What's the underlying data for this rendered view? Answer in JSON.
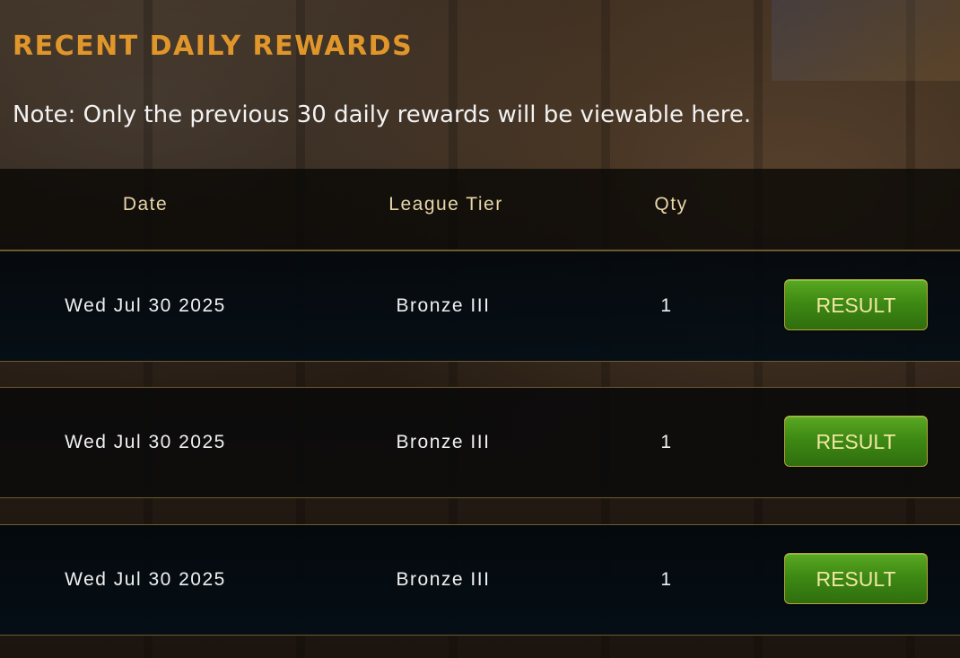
{
  "page": {
    "title": "RECENT DAILY REWARDS",
    "note": "Note: Only the previous 30 daily rewards will be viewable here."
  },
  "table": {
    "headers": {
      "date": "Date",
      "tier": "League Tier",
      "qty": "Qty"
    },
    "rows": [
      {
        "date": "Wed Jul 30 2025",
        "tier": "Bronze III",
        "qty": "1",
        "button": "RESULT"
      },
      {
        "date": "Wed Jul 30 2025",
        "tier": "Bronze III",
        "qty": "1",
        "button": "RESULT"
      },
      {
        "date": "Wed Jul 30 2025",
        "tier": "Bronze III",
        "qty": "1",
        "button": "RESULT"
      }
    ]
  },
  "colors": {
    "title": "#e0962a",
    "header_text": "#e8d6a8",
    "button_green": "#3e8a14",
    "button_text": "#efe6a0",
    "divider": "#6e5a30"
  }
}
